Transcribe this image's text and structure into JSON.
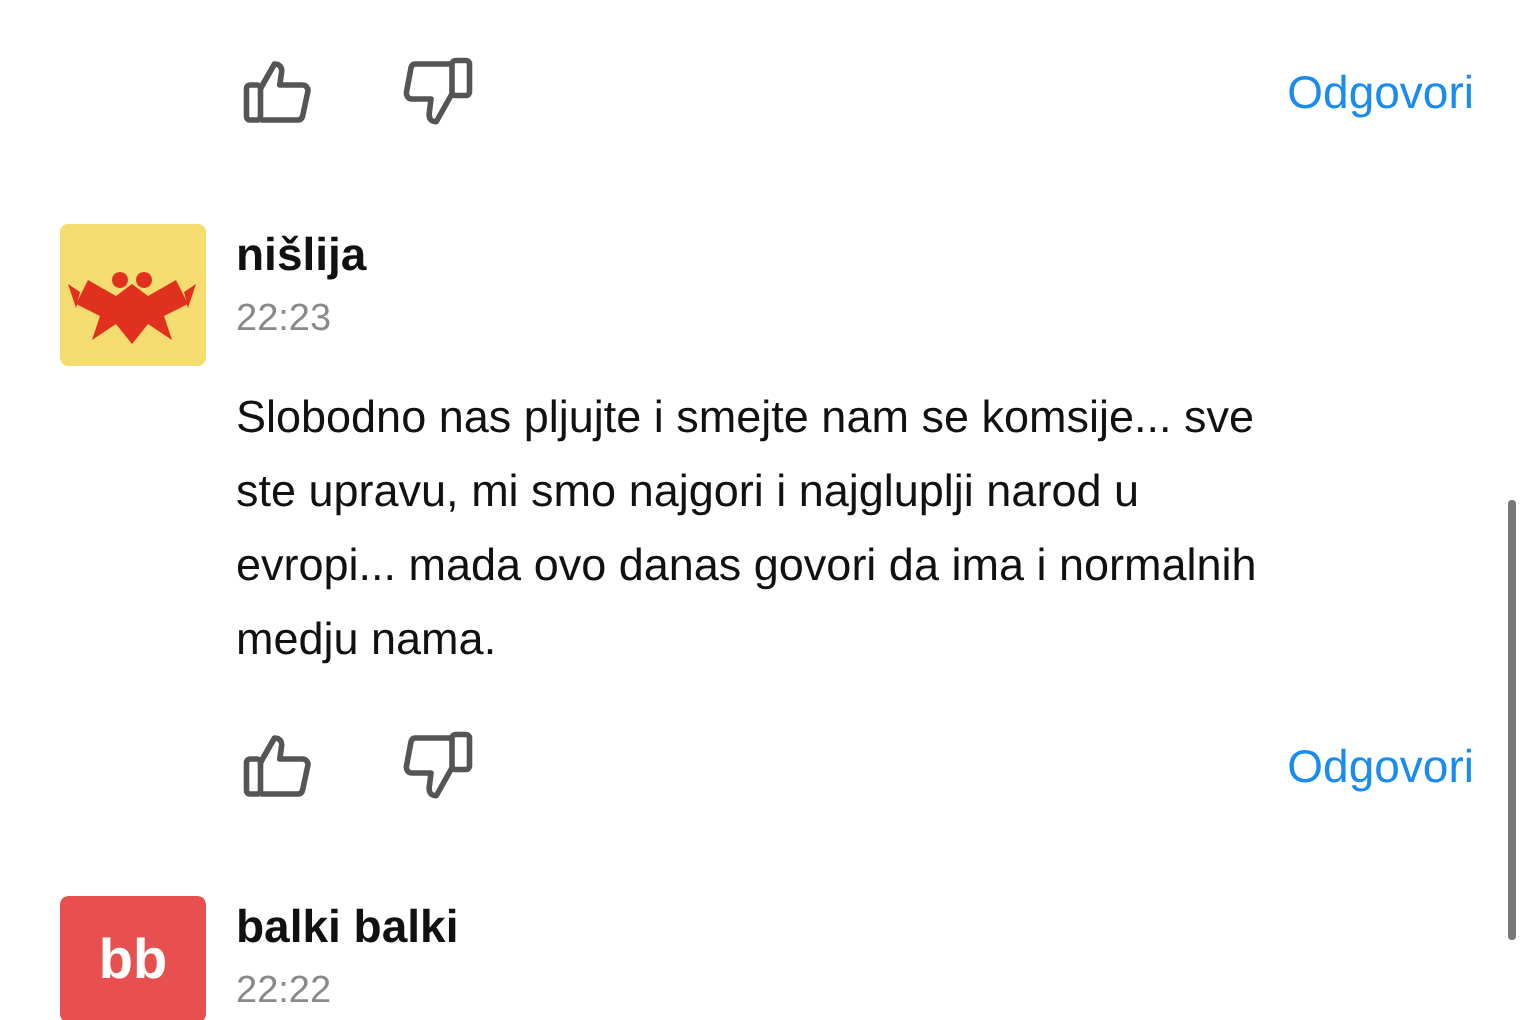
{
  "top_actions": {
    "reply_label": "Odgovori"
  },
  "comments": [
    {
      "author": "nišlija",
      "time": "22:23",
      "body": "Slobodno nas pljujte i smejte nam se komsije... sve ste upravu, mi smo najgori i najgluplji narod u evropi... mada ovo danas govori da ima i normalnih medju nama.",
      "reply_label": "Odgovori"
    },
    {
      "avatar": {
        "kind": "initials",
        "text": "bb"
      },
      "author": "balki balki",
      "time": "22:22"
    }
  ]
}
